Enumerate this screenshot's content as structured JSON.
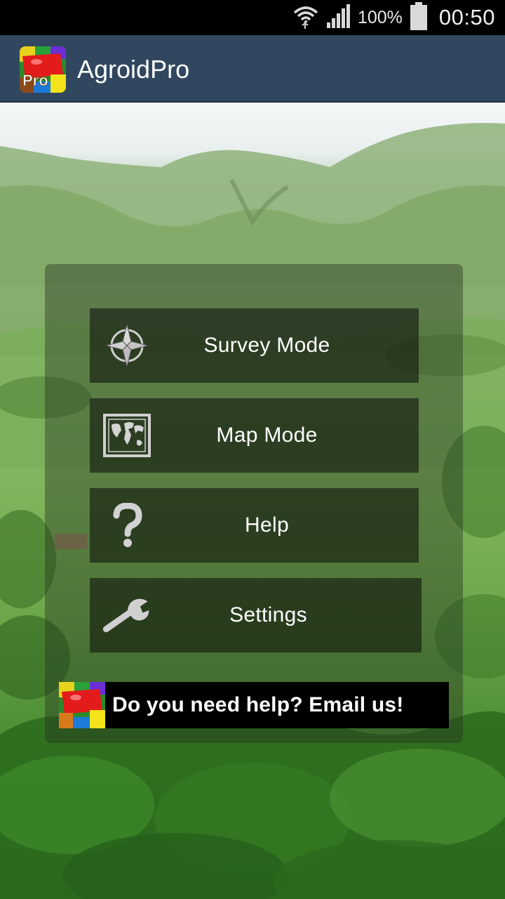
{
  "status_bar": {
    "battery_percent": "100%",
    "time": "00:50",
    "icons": [
      "wifi-icon",
      "signal-icon",
      "battery-icon"
    ]
  },
  "action_bar": {
    "title": "AgroidPro",
    "logo_badge": "Pro",
    "color": "#30475f"
  },
  "menu": {
    "items": [
      {
        "label": "Survey Mode",
        "icon": "compass-icon"
      },
      {
        "label": "Map Mode",
        "icon": "world-map-icon"
      },
      {
        "label": "Help",
        "icon": "question-mark-icon"
      },
      {
        "label": "Settings",
        "icon": "wrench-icon"
      }
    ]
  },
  "banner": {
    "text": "Do you need help? Email us!"
  }
}
